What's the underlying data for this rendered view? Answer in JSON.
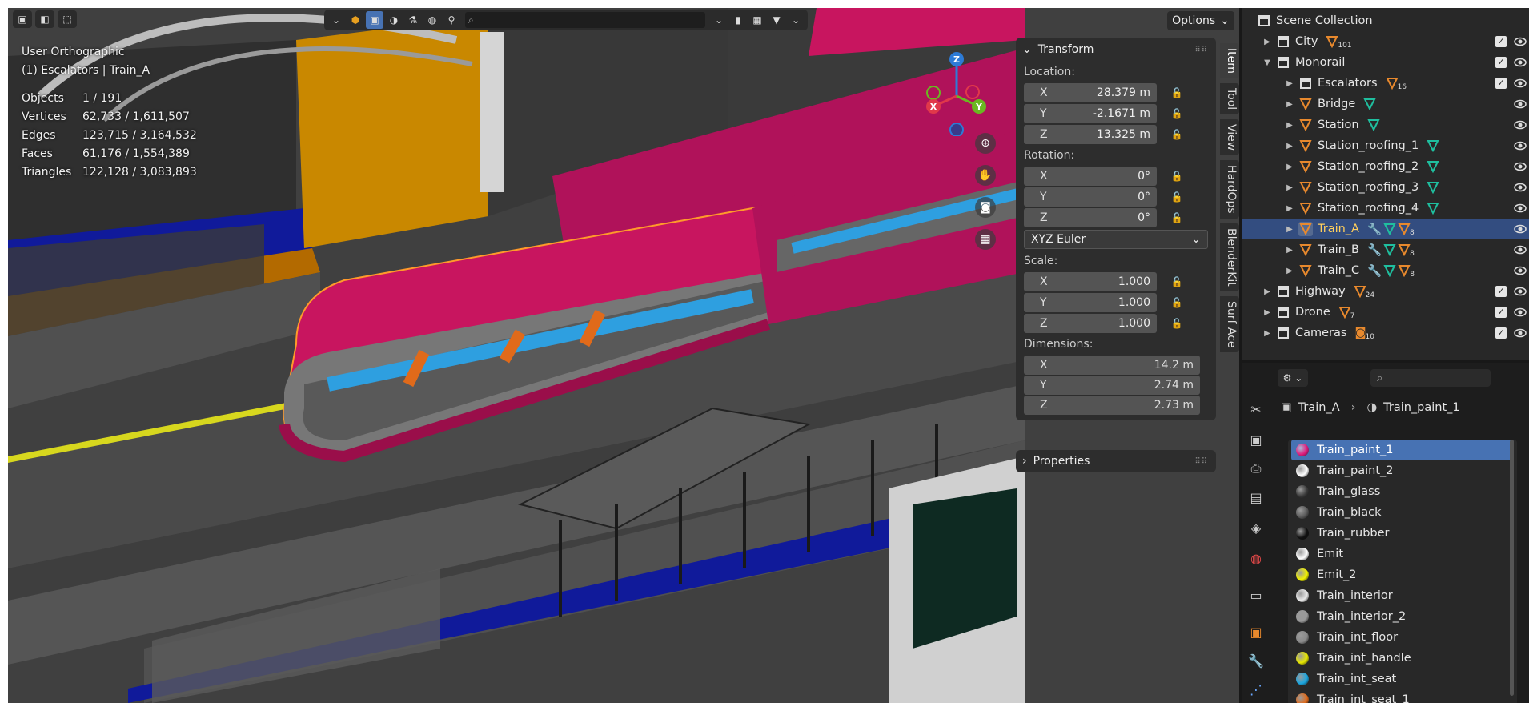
{
  "viewport": {
    "view_name": "User Orthographic",
    "collection_path": "(1) Escalators | Train_A",
    "stats": [
      {
        "label": "Objects",
        "value": "1 / 191"
      },
      {
        "label": "Vertices",
        "value": "62,733 / 1,611,507"
      },
      {
        "label": "Edges",
        "value": "123,715 / 3,164,532"
      },
      {
        "label": "Faces",
        "value": "61,176 / 1,554,389"
      },
      {
        "label": "Triangles",
        "value": "122,128 / 3,083,893"
      }
    ],
    "options_label": "Options",
    "gizmo": {
      "x": "X",
      "y": "Y",
      "z": "Z"
    }
  },
  "npanel": {
    "transform_label": "Transform",
    "location_label": "Location:",
    "location": [
      {
        "axis": "X",
        "value": "28.379 m"
      },
      {
        "axis": "Y",
        "value": "-2.1671 m"
      },
      {
        "axis": "Z",
        "value": "13.325 m"
      }
    ],
    "rotation_label": "Rotation:",
    "rotation": [
      {
        "axis": "X",
        "value": "0°"
      },
      {
        "axis": "Y",
        "value": "0°"
      },
      {
        "axis": "Z",
        "value": "0°"
      }
    ],
    "rotation_mode": "XYZ Euler",
    "scale_label": "Scale:",
    "scale": [
      {
        "axis": "X",
        "value": "1.000"
      },
      {
        "axis": "Y",
        "value": "1.000"
      },
      {
        "axis": "Z",
        "value": "1.000"
      }
    ],
    "dimensions_label": "Dimensions:",
    "dimensions": [
      {
        "axis": "X",
        "value": "14.2 m"
      },
      {
        "axis": "Y",
        "value": "2.74 m"
      },
      {
        "axis": "Z",
        "value": "2.73 m"
      }
    ],
    "properties_label": "Properties",
    "tabs": [
      "Item",
      "Tool",
      "View",
      "HardOps",
      "BlenderKit",
      "Surf Ace"
    ]
  },
  "outliner": {
    "scene_collection": "Scene Collection",
    "items": [
      {
        "name": "City",
        "count": "101"
      },
      {
        "name": "Monorail"
      },
      {
        "name": "Escalators",
        "count": "16"
      },
      {
        "name": "Bridge"
      },
      {
        "name": "Station"
      },
      {
        "name": "Station_roofing_1"
      },
      {
        "name": "Station_roofing_2"
      },
      {
        "name": "Station_roofing_3"
      },
      {
        "name": "Station_roofing_4"
      },
      {
        "name": "Train_A",
        "count": "8"
      },
      {
        "name": "Train_B",
        "count": "8"
      },
      {
        "name": "Train_C",
        "count": "8"
      },
      {
        "name": "Highway",
        "count": "24"
      },
      {
        "name": "Drone",
        "count": "7"
      },
      {
        "name": "Cameras",
        "count": "10"
      }
    ]
  },
  "properties": {
    "breadcrumb_object": "Train_A",
    "breadcrumb_material": "Train_paint_1",
    "materials": [
      {
        "name": "Train_paint_1",
        "color": "#e0197a"
      },
      {
        "name": "Train_paint_2",
        "color": "#ffffff"
      },
      {
        "name": "Train_glass",
        "color": "#3a3a3a"
      },
      {
        "name": "Train_black",
        "color": "#5a5a5a"
      },
      {
        "name": "Train_rubber",
        "color": "#111111"
      },
      {
        "name": "Emit",
        "color": "#ffffff"
      },
      {
        "name": "Emit_2",
        "color": "#f2f200"
      },
      {
        "name": "Train_interior",
        "color": "#e8e8e8"
      },
      {
        "name": "Train_interior_2",
        "color": "#9a9a9a"
      },
      {
        "name": "Train_int_floor",
        "color": "#8a8a8a"
      },
      {
        "name": "Train_int_handle",
        "color": "#e8e800"
      },
      {
        "name": "Train_int_seat",
        "color": "#1aa6e0"
      },
      {
        "name": "Train_int_seat_1",
        "color": "#e06a1a"
      }
    ]
  },
  "colors": {
    "accent": "#4772b3",
    "selected_row": "#334d80",
    "train": "#c8155f"
  }
}
